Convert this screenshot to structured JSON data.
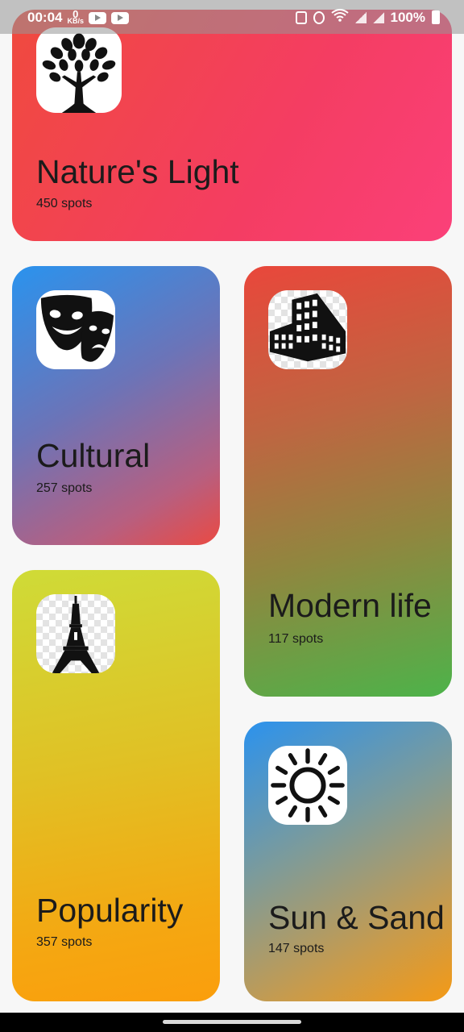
{
  "status_bar": {
    "time": "00:04",
    "net_speed_value": "0",
    "net_speed_unit": "KB/s",
    "battery": "100%"
  },
  "cards": [
    {
      "title": "Nature's Light",
      "count": "450 spots",
      "icon": "tree-icon"
    },
    {
      "title": "Cultural",
      "count": "257 spots",
      "icon": "theater-masks-icon"
    },
    {
      "title": "Modern life",
      "count": "117 spots",
      "icon": "building-icon"
    },
    {
      "title": "Popularity",
      "count": "357 spots",
      "icon": "eiffel-tower-icon"
    },
    {
      "title": "Sun & Sand",
      "count": "147 spots",
      "icon": "sun-icon"
    }
  ],
  "colors": {
    "nature_gradient": [
      "#f04a3e",
      "#fb4079"
    ],
    "cultural_gradient": [
      "#2a93ee",
      "#ea4a43"
    ],
    "modern_gradient": [
      "#e9473b",
      "#4db34a"
    ],
    "popularity_gradient": [
      "#cfdb37",
      "#fb9e0c"
    ],
    "sun_gradient": [
      "#2b92ee",
      "#f49a16"
    ]
  }
}
